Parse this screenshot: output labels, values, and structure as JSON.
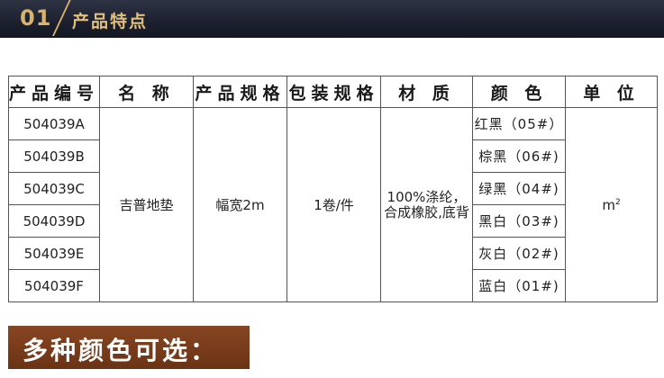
{
  "banner": {
    "number": "01",
    "title": "产品特点"
  },
  "table": {
    "headers": [
      "产品编号",
      "名 称",
      "产品规格",
      "包装规格",
      "材 质",
      "颜 色",
      "单 位"
    ],
    "codes": [
      "504039A",
      "504039B",
      "504039C",
      "504039D",
      "504039E",
      "504039F"
    ],
    "name": "吉普地垫",
    "spec": "幅宽2m",
    "packing": "1卷/件",
    "material_line1": "100%涤纶，",
    "material_line2": "合成橡胶,底背",
    "colors": [
      "红黑（05#）",
      "棕黑（06#)",
      "绿黑（04#)",
      "黑白（03#)",
      "灰白（02#)",
      "蓝白（01#)"
    ],
    "unit": "m",
    "unit_sup": "2"
  },
  "bottom_banner": {
    "title": "多种颜色可选："
  },
  "colors": {
    "banner_bg": "#1d2130",
    "banner_text": "#d9b36a",
    "bottom_bg": "#7a3c1b"
  }
}
